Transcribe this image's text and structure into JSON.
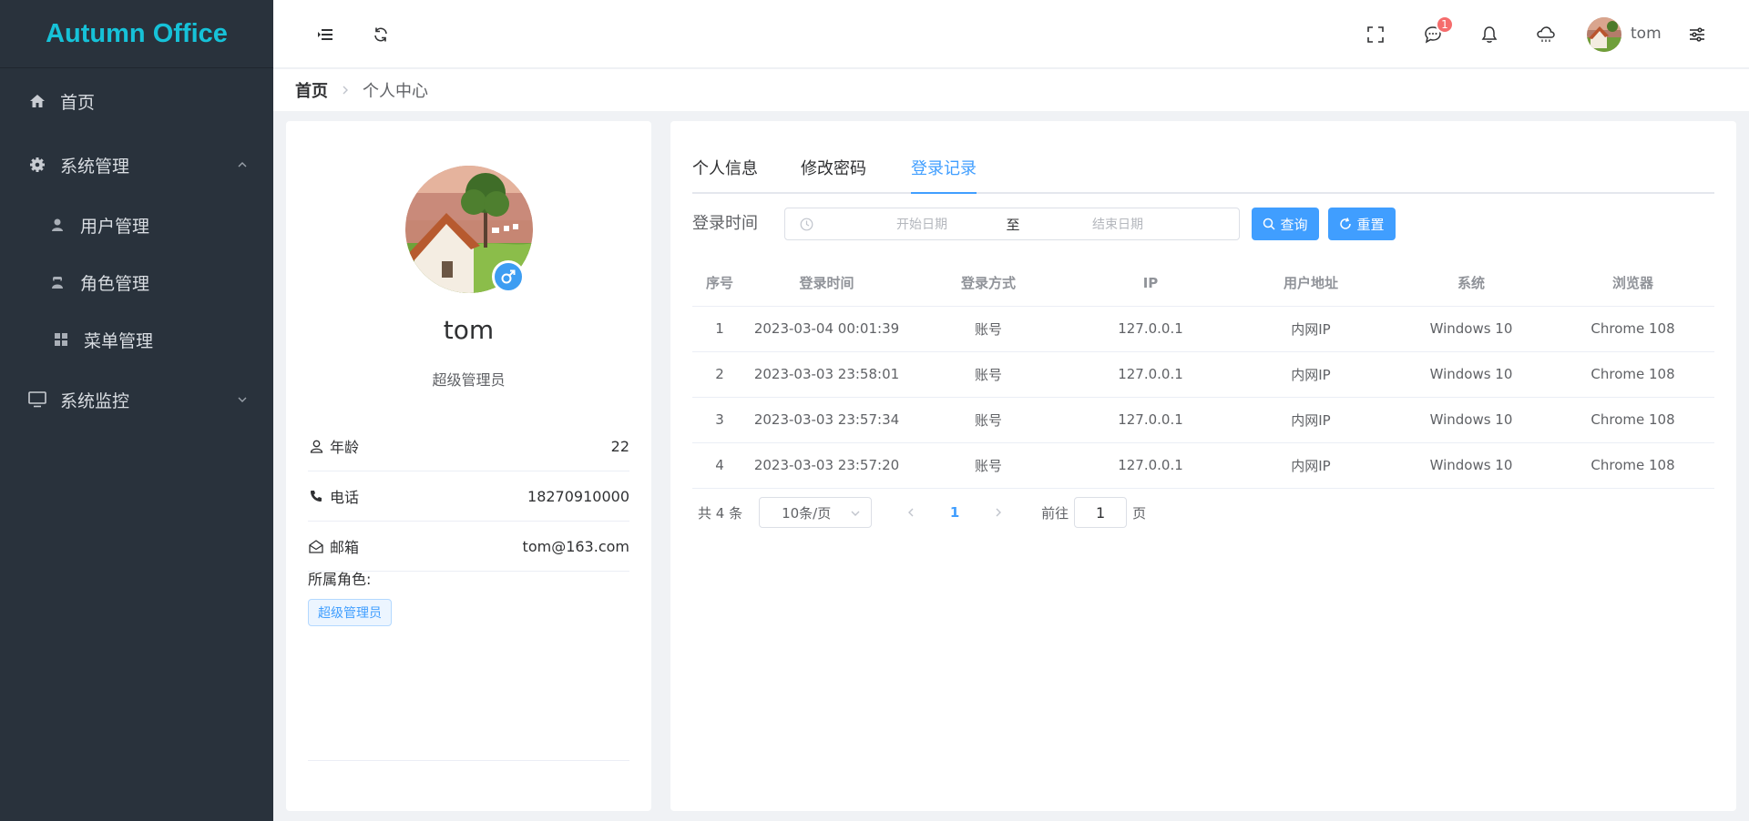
{
  "app": {
    "title": "Autumn Office"
  },
  "sidebar": {
    "items": [
      {
        "label": "首页",
        "icon": "home-icon"
      },
      {
        "label": "系统管理",
        "icon": "gear-icon",
        "expanded": true
      },
      {
        "label": "用户管理",
        "icon": "user-icon"
      },
      {
        "label": "角色管理",
        "icon": "role-icon"
      },
      {
        "label": "菜单管理",
        "icon": "grid-icon"
      },
      {
        "label": "系统监控",
        "icon": "monitor-icon",
        "expanded": false
      }
    ]
  },
  "header": {
    "notification_count": "1",
    "username": "tom"
  },
  "breadcrumb": {
    "home": "首页",
    "current": "个人中心"
  },
  "profile": {
    "name": "tom",
    "role": "超级管理员",
    "age_label": "年龄",
    "age": "22",
    "phone_label": "电话",
    "phone": "18270910000",
    "email_label": "邮箱",
    "email": "tom@163.com",
    "roles_title": "所属角色:",
    "role_tag": "超级管理员"
  },
  "tabs": [
    {
      "label": "个人信息"
    },
    {
      "label": "修改密码"
    },
    {
      "label": "登录记录",
      "active": true
    }
  ],
  "filter": {
    "label": "登录时间",
    "start_placeholder": "开始日期",
    "separator": "至",
    "end_placeholder": "结束日期",
    "search_button": "查询",
    "reset_button": "重置"
  },
  "table": {
    "headers": [
      "序号",
      "登录时间",
      "登录方式",
      "IP",
      "用户地址",
      "系统",
      "浏览器"
    ],
    "rows": [
      [
        "1",
        "2023-03-04 00:01:39",
        "账号",
        "127.0.0.1",
        "内网IP",
        "Windows 10",
        "Chrome 108"
      ],
      [
        "2",
        "2023-03-03 23:58:01",
        "账号",
        "127.0.0.1",
        "内网IP",
        "Windows 10",
        "Chrome 108"
      ],
      [
        "3",
        "2023-03-03 23:57:34",
        "账号",
        "127.0.0.1",
        "内网IP",
        "Windows 10",
        "Chrome 108"
      ],
      [
        "4",
        "2023-03-03 23:57:20",
        "账号",
        "127.0.0.1",
        "内网IP",
        "Windows 10",
        "Chrome 108"
      ]
    ]
  },
  "pagination": {
    "total": "共 4 条",
    "page_size": "10条/页",
    "current_page": "1",
    "goto_prefix": "前往",
    "goto_value": "1",
    "goto_suffix": "页"
  },
  "colors": {
    "sidebar_bg": "#29323c",
    "logo": "#16c2d8",
    "primary": "#409eff",
    "badge": "#f56c6c"
  }
}
